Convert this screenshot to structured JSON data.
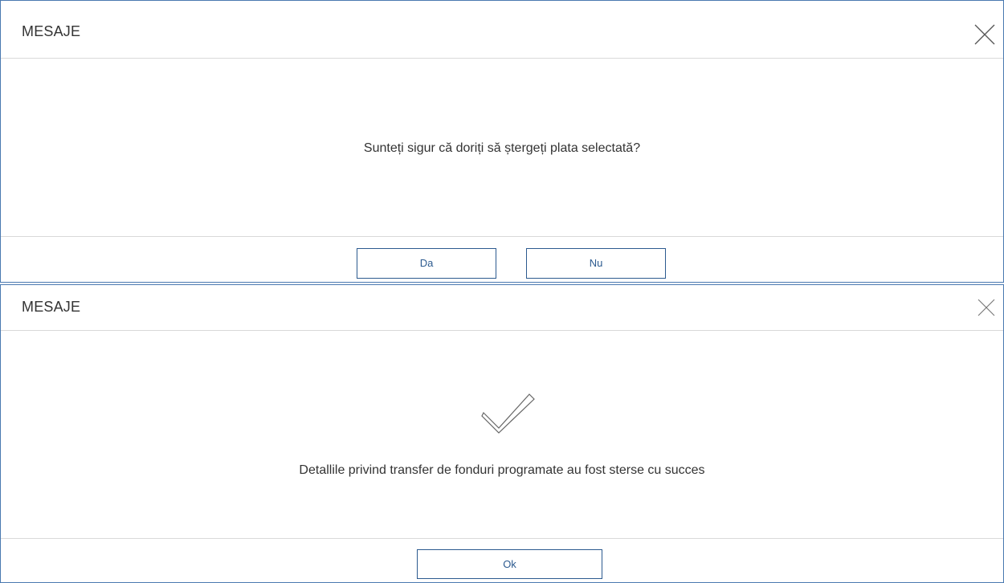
{
  "confirm_dialog": {
    "title": "MESAJE",
    "message": "Sunteți sigur că doriți să ștergeți plata selectată?",
    "buttons": {
      "yes": "Da",
      "no": "Nu"
    },
    "close_icon": "close-icon"
  },
  "success_dialog": {
    "title": "MESAJE",
    "message": "Detallile privind transfer de fonduri programate au fost sterse cu succes",
    "status_icon": "checkmark-icon",
    "buttons": {
      "ok": "Ok"
    },
    "close_icon": "close-icon"
  },
  "colors": {
    "border": "#4a79b0",
    "button": "#2c5a8f",
    "divider": "#d9d9d9",
    "text": "#333333"
  }
}
